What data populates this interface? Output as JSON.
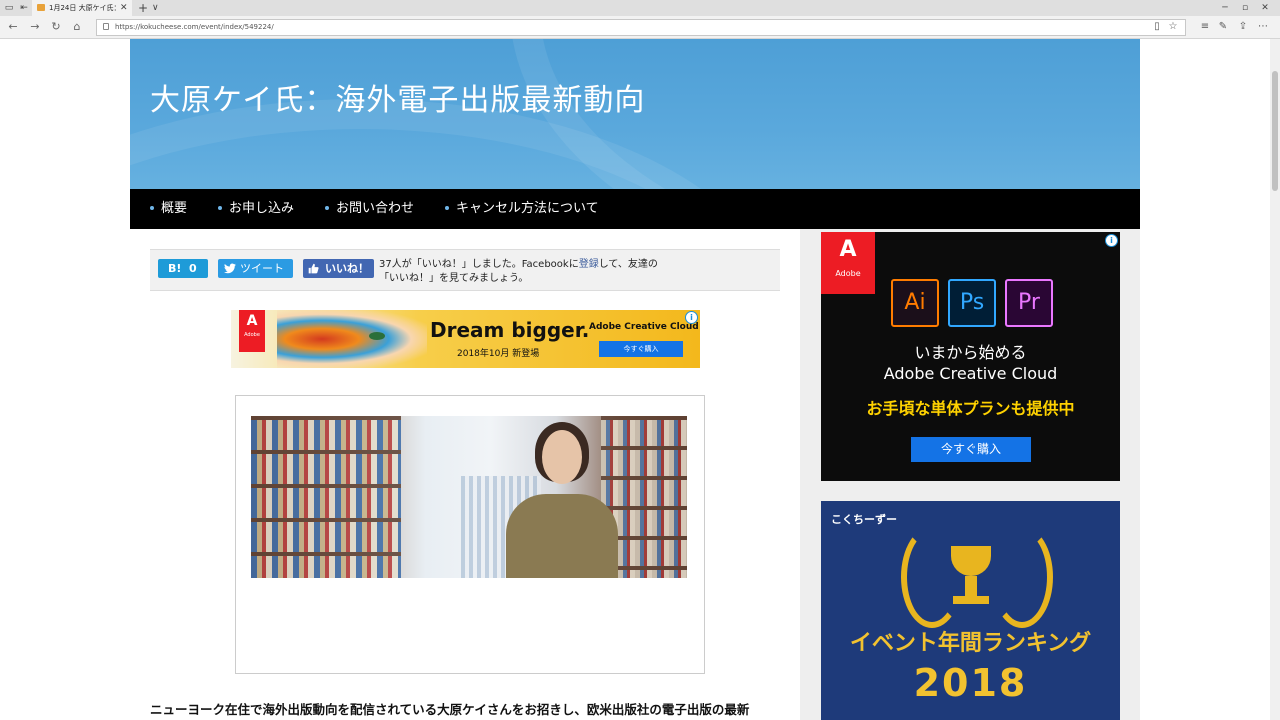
{
  "browser": {
    "tab_title": "1月24日 大原ケイ氏：海",
    "new_tab": "+",
    "tab_menu": "∨",
    "url": "https://kokucheese.com/event/index/549224/",
    "window_min": "─",
    "window_max": "▫",
    "window_close": "✕"
  },
  "site": {
    "title": "大原ケイ氏：海外電子出版最新動向",
    "menu": [
      {
        "label": "概要"
      },
      {
        "label": "お申し込み"
      },
      {
        "label": "お問い合わせ"
      },
      {
        "label": "キャンセル方法について"
      }
    ]
  },
  "social": {
    "hatena_label": "B!",
    "hatena_count": "0",
    "tweet_label": "ツイート",
    "fb_like_label": "いいね！",
    "fb_text_before": "37人が「いいね！」しました。Facebookに",
    "fb_text_link": "登録",
    "fb_text_after": "して、友達の「いいね！」を見てみましょう。"
  },
  "banner_ad": {
    "brand": "Adobe",
    "headline": "Dream bigger.",
    "date": "2018年10月 新登場",
    "product": "Adobe Creative Cloud",
    "cta": "今すぐ購入",
    "info_icon": "i"
  },
  "body": {
    "intro": "ニューヨーク在住で海外出版動向を配信されている大原ケイさんをお招きし、欧米出版社の電子出版の最新"
  },
  "sidebar_ad1": {
    "brand": "Adobe",
    "apps": [
      "Ai",
      "Ps",
      "Pr"
    ],
    "line1": "いまから始める",
    "line2": "Adobe Creative Cloud",
    "line3": "お手頃な単体プランも提供中",
    "cta": "今すぐ購入",
    "info_icon": "i"
  },
  "sidebar_ad2": {
    "logo": "こくちーずー",
    "title": "イベント年間ランキング",
    "year": "2018"
  },
  "colors": {
    "hero_blue": "#4e9fd6",
    "menu_bg": "#000000",
    "adobe_red": "#ed1c24",
    "adobe_blue": "#1473e6",
    "gold": "#f2c230"
  },
  "icons": {
    "back": "←",
    "forward": "→",
    "refresh": "↻",
    "home": "⌂",
    "reading": "▯",
    "favorite": "☆",
    "hub": "≡",
    "note": "✎",
    "share": "⇪",
    "more": "⋯"
  }
}
